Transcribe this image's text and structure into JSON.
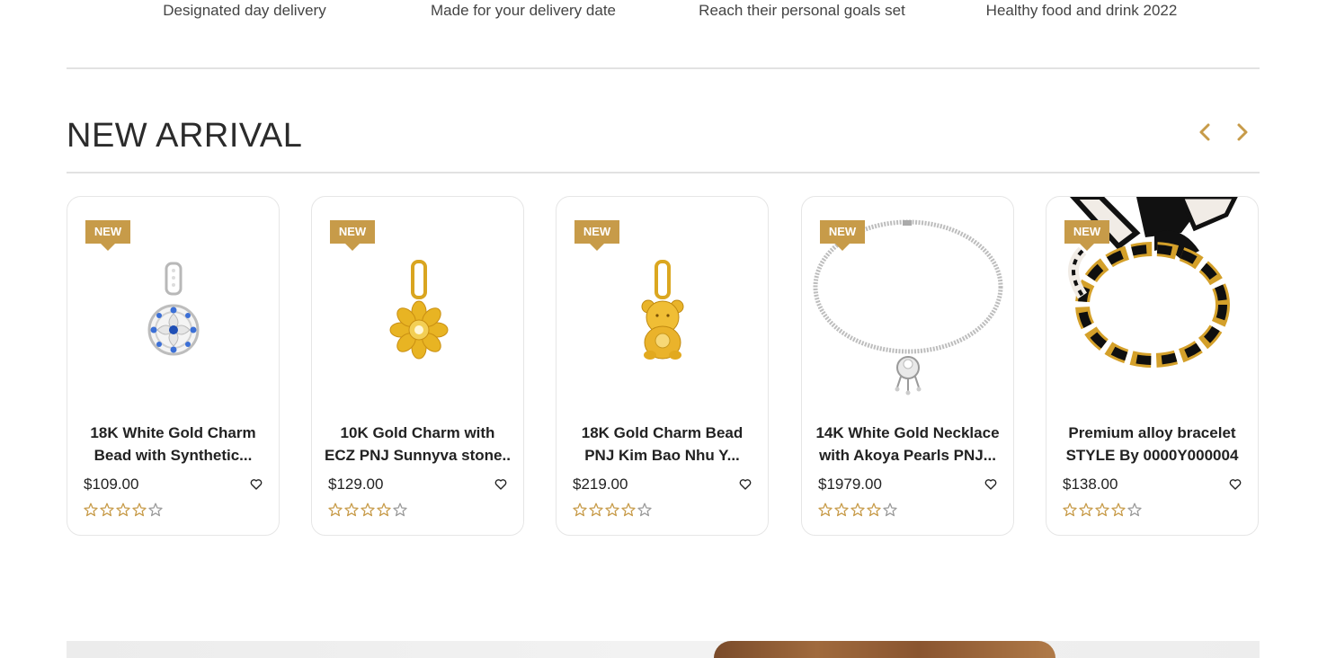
{
  "features": [
    "Designated day delivery",
    "Made for your delivery date",
    "Reach their personal goals set",
    "Healthy food and drink 2022"
  ],
  "section": {
    "title": "NEW ARRIVAL",
    "prev_icon": "chevron-left-icon",
    "next_icon": "chevron-right-icon"
  },
  "colors": {
    "accent": "#c79b49",
    "text": "#222222"
  },
  "products": [
    {
      "badge": "NEW",
      "name": "18K White Gold Charm Bead with Synthetic...",
      "price": "$109.00",
      "rating": 4,
      "image": "white-gold-charm-image"
    },
    {
      "badge": "NEW",
      "name": "10K Gold Charm with ECZ PNJ Sunnyva stone..",
      "price": "$129.00",
      "rating": 4,
      "image": "sunflower-charm-image"
    },
    {
      "badge": "NEW",
      "name": "18K Gold Charm Bead PNJ Kim Bao Nhu Y...",
      "price": "$219.00",
      "rating": 4,
      "image": "bear-charm-image"
    },
    {
      "badge": "NEW",
      "name": "14K White Gold Necklace with Akoya Pearls PNJ...",
      "price": "$1979.00",
      "rating": 4,
      "image": "necklace-image"
    },
    {
      "badge": "NEW",
      "name": "Premium alloy bracelet STYLE By 0000Y000004",
      "price": "$138.00",
      "rating": 4,
      "image": "bracelet-image"
    }
  ]
}
